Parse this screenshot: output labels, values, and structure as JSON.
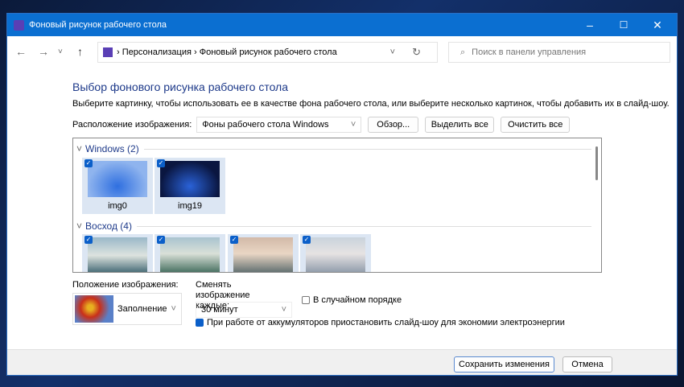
{
  "window": {
    "title": "Фоновый рисунок рабочего стола",
    "min": "–",
    "max": "☐",
    "close": "✕"
  },
  "nav": {
    "back": "←",
    "forward": "→",
    "recent": "˅",
    "up": "↑",
    "breadcrumb": [
      "Персонализация",
      "Фоновый рисунок рабочего стола"
    ],
    "sep": "›",
    "dropdown": "˅",
    "refresh": "↻",
    "search_placeholder": "Поиск в панели управления",
    "search_icon": "⌕"
  },
  "main": {
    "title": "Выбор фонового рисунка рабочего стола",
    "description": "Выберите картинку, чтобы использовать ее в качестве фона рабочего стола, или выберите несколько картинок, чтобы добавить их в слайд-шоу.",
    "location_label": "Расположение изображения:",
    "location_value": "Фоны рабочего стола Windows",
    "browse": "Обзор...",
    "select_all": "Выделить все",
    "clear_all": "Очистить все"
  },
  "gallery": {
    "groups": [
      {
        "name": "Windows (2)",
        "items": [
          "img0",
          "img19"
        ]
      },
      {
        "name": "Восход (4)",
        "items": [
          "",
          "",
          "",
          ""
        ]
      }
    ]
  },
  "options": {
    "position_label": "Положение изображения:",
    "position_value": "Заполнение",
    "interval_label": "Сменять изображение каждые:",
    "interval_value": "30 минут",
    "shuffle_label": "В случайном порядке",
    "shuffle_checked": false,
    "battery_label": "При работе от аккумуляторов приостановить слайд-шоу для экономии электроэнергии",
    "battery_checked": true
  },
  "footer": {
    "save": "Сохранить изменения",
    "cancel": "Отмена"
  }
}
